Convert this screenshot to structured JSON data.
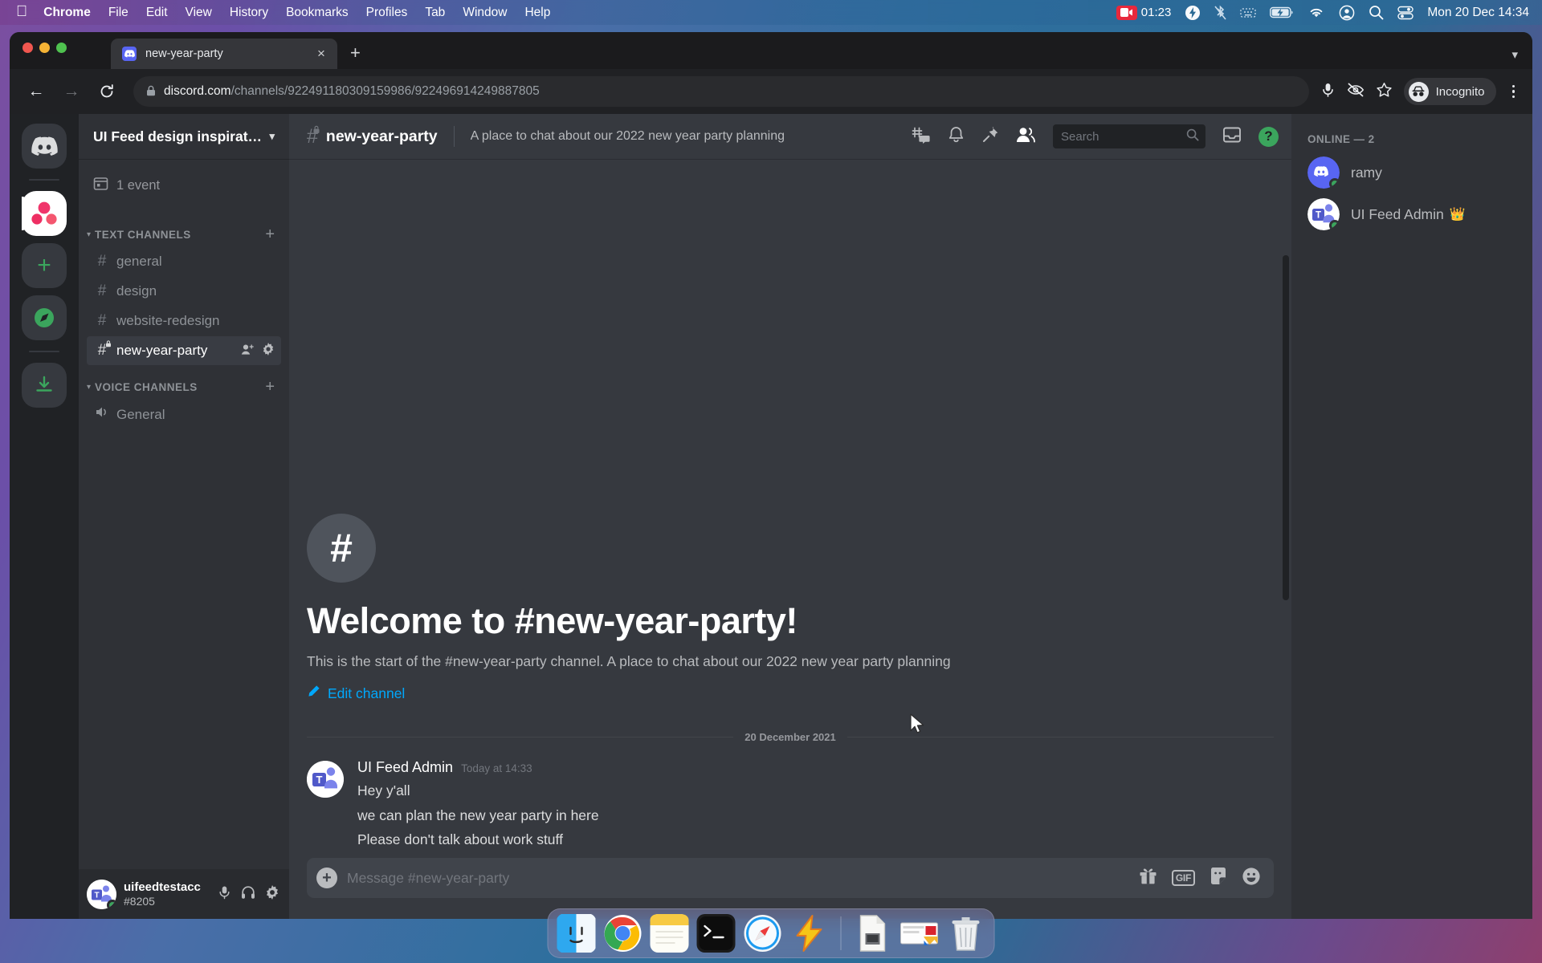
{
  "menubar": {
    "apple_icon": "apple-logo-icon",
    "items": [
      {
        "label": "Chrome",
        "bold": true
      },
      {
        "label": "File",
        "bold": false
      },
      {
        "label": "Edit",
        "bold": false
      },
      {
        "label": "View",
        "bold": false
      },
      {
        "label": "History",
        "bold": false
      },
      {
        "label": "Bookmarks",
        "bold": false
      },
      {
        "label": "Profiles",
        "bold": false
      },
      {
        "label": "Tab",
        "bold": false
      },
      {
        "label": "Window",
        "bold": false
      },
      {
        "label": "Help",
        "bold": false
      }
    ],
    "recording_time": "01:23",
    "status_icons": [
      "screen-recording-icon",
      "bolt-icon",
      "bluetooth-off-icon",
      "keyboard-brightness-icon",
      "battery-charging-icon",
      "wifi-icon",
      "account-icon",
      "search-icon",
      "control-center-icon"
    ],
    "clock": "Mon 20 Dec  14:34"
  },
  "browser": {
    "tab": {
      "title": "new-year-party",
      "favicon": "discord-icon",
      "close_label": "×"
    },
    "newtab_label": "+",
    "tabstrip_chevron": "chevron-down-icon",
    "url_host": "discord.com",
    "url_path": "/channels/922491180309159986/922496914249887805",
    "profile_label": "Incognito",
    "toolbar_icons": [
      "back-arrow-icon",
      "forward-arrow-icon",
      "reload-icon",
      "lock-icon",
      "microphone-icon",
      "eye-off-icon",
      "bookmark-star-icon",
      "incognito-icon",
      "kebab-menu-icon"
    ]
  },
  "discord": {
    "server_rail": [
      {
        "name": "home-discord-button",
        "type": "discord-logo",
        "active": false
      },
      {
        "name": "server-ui-feed-button",
        "type": "server-avatar",
        "active": true
      },
      {
        "name": "add-server-button",
        "type": "plus",
        "active": false
      },
      {
        "name": "explore-servers-button",
        "type": "compass",
        "active": false
      },
      {
        "name": "download-apps-button",
        "type": "download",
        "active": false
      }
    ],
    "guild_name": "UI Feed design inspiration",
    "events_label": "1 event",
    "categories": [
      {
        "label": "TEXT CHANNELS",
        "channels": [
          {
            "name": "general",
            "active": false,
            "locked": false
          },
          {
            "name": "design",
            "active": false,
            "locked": false
          },
          {
            "name": "website-redesign",
            "active": false,
            "locked": false
          },
          {
            "name": "new-year-party",
            "active": true,
            "locked": true
          }
        ]
      },
      {
        "label": "VOICE CHANNELS",
        "channels": [
          {
            "name": "General",
            "active": false,
            "voice": true
          }
        ]
      }
    ],
    "user_panel": {
      "username": "uifeedtestacc",
      "discriminator": "#8205",
      "status": "online",
      "icons": [
        "microphone-icon",
        "headphones-icon",
        "user-settings-gear-icon"
      ]
    },
    "channel_header": {
      "name": "new-year-party",
      "topic": "A place to chat about our 2022 new year party planning",
      "icons": [
        "threads-icon",
        "notification-bell-icon",
        "pinned-messages-icon",
        "member-list-icon",
        "inbox-icon",
        "help-icon"
      ],
      "search_placeholder": "Search",
      "search_value": "",
      "help_label": "?"
    },
    "welcome": {
      "hash": "#",
      "title": "Welcome to #new-year-party!",
      "subtitle": "This is the start of the #new-year-party channel. A place to chat about our 2022 new year party planning",
      "edit_label": "Edit channel",
      "edit_icon": "pencil-icon"
    },
    "day_divider": "20 December 2021",
    "messages": [
      {
        "author": "UI Feed Admin",
        "timestamp": "Today at 14:33",
        "avatar": "teams-avatar",
        "lines": [
          "Hey y'all",
          "we can plan the new year party in here",
          "Please don't talk about work stuff"
        ]
      }
    ],
    "composer": {
      "placeholder": "Message #new-year-party",
      "value": "",
      "plus_label": "+",
      "gif_label": "GIF",
      "icons": [
        "gift-icon",
        "gif-icon",
        "sticker-icon",
        "emoji-icon"
      ]
    },
    "members": {
      "heading": "ONLINE — 2",
      "list": [
        {
          "name": "ramy",
          "avatar": "discord-avatar",
          "status": "online",
          "crown": ""
        },
        {
          "name": "UI Feed Admin",
          "avatar": "teams-avatar",
          "status": "online",
          "crown": "👑"
        }
      ]
    }
  },
  "dock": {
    "items": [
      {
        "name": "finder-icon",
        "running": true
      },
      {
        "name": "chrome-icon",
        "running": true
      },
      {
        "name": "notes-icon",
        "running": true
      },
      {
        "name": "terminal-icon",
        "running": true
      },
      {
        "name": "safari-icon",
        "running": true
      },
      {
        "name": "lightning-app-icon",
        "running": true
      }
    ],
    "extras": [
      {
        "name": "document-icon"
      },
      {
        "name": "screenshot-thumbnail-icon"
      },
      {
        "name": "trash-icon"
      }
    ]
  },
  "colors": {
    "discord_blurple": "#5865f2",
    "discord_green": "#3ba55d",
    "link_blue": "#00a8fc",
    "sidebar_bg": "#2f3136",
    "chat_bg": "#36393f",
    "rail_bg": "#202225"
  }
}
